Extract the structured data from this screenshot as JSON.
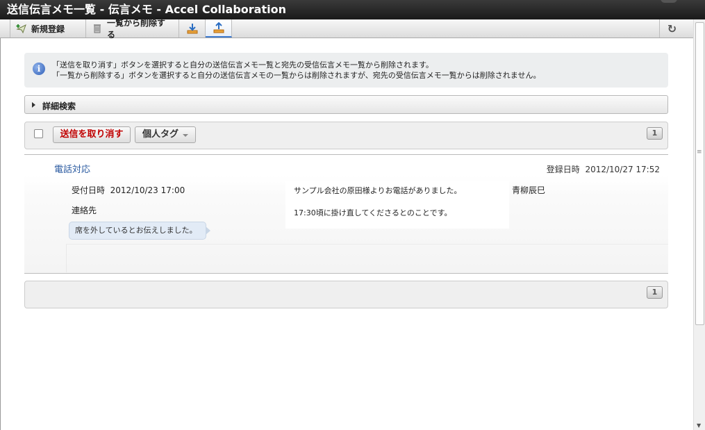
{
  "window": {
    "title": "送信伝言メモ一覧 - 伝言メモ - Accel Collaboration"
  },
  "toolbar": {
    "new_label": "新規登録",
    "delete_label": "一覧から削除する",
    "icons": [
      "add-icon",
      "trash-icon",
      "download-icon",
      "upload-icon",
      "refresh-icon"
    ]
  },
  "info": {
    "line1": "「送信を取り消す」ボタンを選択すると自分の送信伝言メモ一覧と宛先の受信伝言メモ一覧から削除されます。",
    "line2": "「一覧から削除する」ボタンを選択すると自分の送信伝言メモの一覧からは削除されますが、宛先の受信伝言メモ一覧からは削除されません。"
  },
  "search": {
    "label": "詳細検索"
  },
  "actions": {
    "cancel_send_label": "送信を取り消す",
    "personal_tag_label": "個人タグ",
    "page": "1"
  },
  "memo": {
    "subject": "電話対応",
    "registered_label": "登録日時",
    "registered_value": "2012/10/27 17:52",
    "received_label": "受付日時",
    "received_value": "2012/10/23 17:00",
    "contact_label": "連絡先",
    "note": "席を外しているとお伝えしました。",
    "message_line1": "サンプル会社の原田様よりお電話がありました。",
    "message_line2": "17:30頃に掛け直してくださるとのことです。",
    "author": "青柳辰巳"
  },
  "footer": {
    "page": "1"
  },
  "colors": {
    "accent": "#3d7bd0",
    "danger": "#c00000",
    "link": "#2a5aa0"
  }
}
